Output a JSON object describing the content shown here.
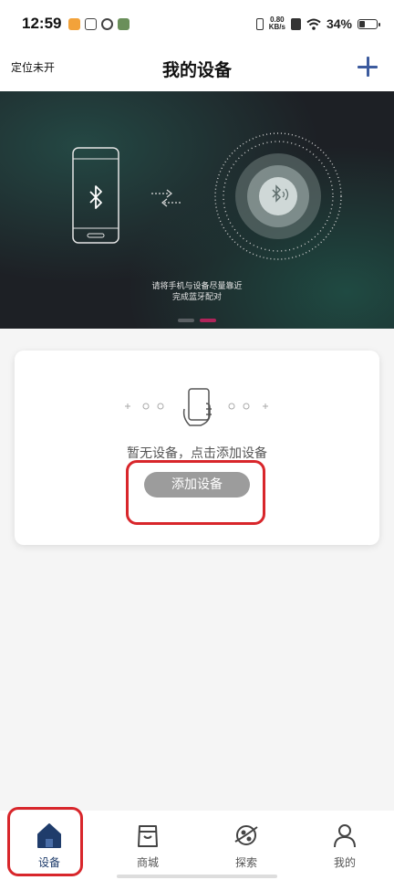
{
  "status_bar": {
    "time": "12:59",
    "net_speed_value": "0.80",
    "net_speed_unit": "KB/s",
    "battery": "34%"
  },
  "header": {
    "location": "定位未开",
    "title": "我的设备"
  },
  "banner": {
    "hint_line1": "请将手机与设备尽量靠近",
    "hint_line2": "完成蓝牙配对",
    "slides": 2,
    "active_slide": 2
  },
  "card": {
    "empty_text": "暂无设备，点击添加设备",
    "add_button": "添加设备"
  },
  "tabs": [
    {
      "label": "设备",
      "icon": "home-icon",
      "active": true
    },
    {
      "label": "商城",
      "icon": "shop-bag-icon",
      "active": false
    },
    {
      "label": "探索",
      "icon": "planet-icon",
      "active": false
    },
    {
      "label": "我的",
      "icon": "person-icon",
      "active": false
    }
  ],
  "colors": {
    "accent": "#3c5b9e",
    "tab_active": "#1f3c6b",
    "highlight": "#d8262b",
    "button": "#9c9c9c",
    "carousel_active": "#b0245a"
  }
}
